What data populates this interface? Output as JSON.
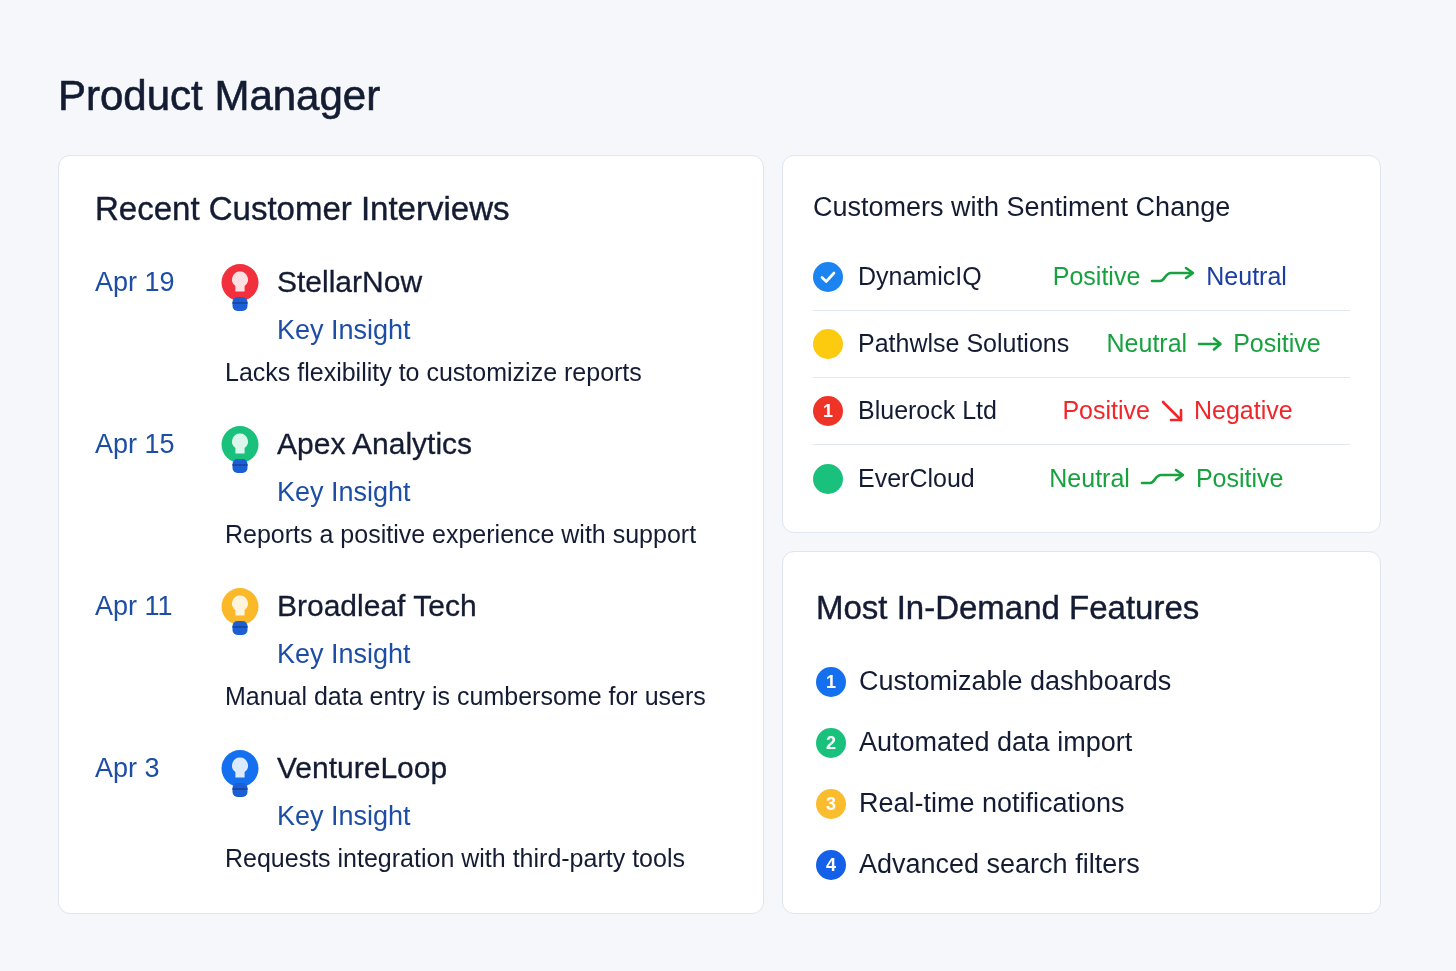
{
  "page": {
    "title": "Product Manager"
  },
  "interviews": {
    "title": "Recent Customer Interviews",
    "items": [
      {
        "date": "Apr 19",
        "color": "#f2303d",
        "company": "StellarNow",
        "label": "Key Insight",
        "insight": "Lacks flexibility to customizize reports"
      },
      {
        "date": "Apr 15",
        "color": "#19c17c",
        "company": "Apex Analytics",
        "label": "Key Insight",
        "insight": "Reports a positive experience with support"
      },
      {
        "date": "Apr 11",
        "color": "#fbb829",
        "company": "Broadleaf Tech",
        "label": "Key Insight",
        "insight": "Manual data entry is cumbersome for users"
      },
      {
        "date": "Apr 3",
        "color": "#1570ef",
        "company": "VentureLoop",
        "label": "Key Insight",
        "insight": "Requests integration with third-party tools"
      }
    ]
  },
  "sentiment": {
    "title": "Customers with Sentiment Change",
    "items": [
      {
        "marker": {
          "kind": "check",
          "color": "#1b84f0"
        },
        "name": "DynamicIQ",
        "from": {
          "text": "Positive",
          "color": "#17a23f"
        },
        "arrow": {
          "kind": "wavy"
        },
        "to": {
          "text": "Neutral",
          "color": "#1c3ea3"
        }
      },
      {
        "marker": {
          "kind": "dot",
          "color": "#fccb0f"
        },
        "name": "Pathwlse Solutions",
        "from": {
          "text": "Neutral",
          "color": "#17a23f"
        },
        "arrow": {
          "kind": "straight"
        },
        "to": {
          "text": "Positive",
          "color": "#17a23f"
        }
      },
      {
        "marker": {
          "kind": "count",
          "color": "#ef3327",
          "count": "1"
        },
        "name": "Bluerock Ltd",
        "from": {
          "text": "Positive",
          "color": "#f2262a"
        },
        "arrow": {
          "kind": "down"
        },
        "to": {
          "text": "Negative",
          "color": "#f2262a"
        }
      },
      {
        "marker": {
          "kind": "dot",
          "color": "#19c17c"
        },
        "name": "EverCloud",
        "from": {
          "text": "Neutral",
          "color": "#17a23f"
        },
        "arrow": {
          "kind": "wavy"
        },
        "to": {
          "text": "Positive",
          "color": "#17a23f"
        }
      }
    ]
  },
  "features": {
    "title": "Most In-Demand Features",
    "items": [
      {
        "number": "1",
        "color": "#1570ef",
        "text": "Customizable dashboards"
      },
      {
        "number": "2",
        "color": "#19c17c",
        "text": "Automated data import"
      },
      {
        "number": "3",
        "color": "#fbbd2e",
        "text": "Real-time notifications"
      },
      {
        "number": "4",
        "color": "#1460e8",
        "text": "Advanced search filters"
      }
    ]
  }
}
